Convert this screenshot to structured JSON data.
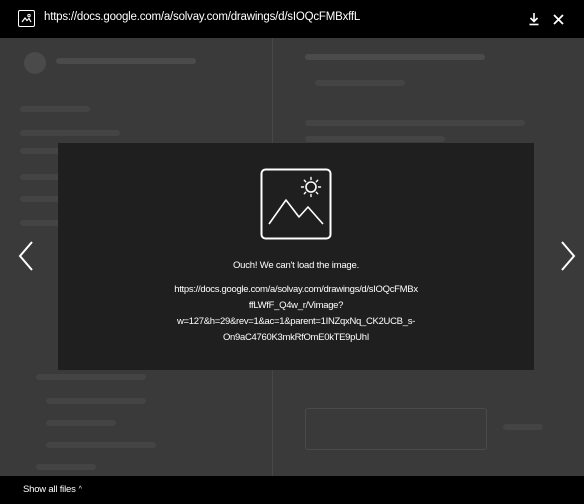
{
  "viewer": {
    "url": "https://docs.google.com/a/solvay.com/drawings/d/sIOQcFMBxffL",
    "download_icon": "download-icon",
    "close_icon": "close-icon",
    "file_icon": "drawing-file-icon"
  },
  "error": {
    "icon": "broken-image-icon",
    "message": "Ouch! We can't load the image.",
    "url_lines": [
      "https://docs.google.com/a/solvay.com/drawings/d/sIOQcFMBx",
      "ffLWfF_Q4w_r/Vimage?",
      "w=127&h=29&rev=1&ac=1&parent=1INZqxNq_CK2UCB_s-",
      "On9aC4760K3mkRfOmE0kTE9pUhI"
    ]
  },
  "navigation": {
    "prev_icon": "chevron-left-icon",
    "next_icon": "chevron-right-icon"
  },
  "footer": {
    "show_all_label": "Show all files",
    "show_all_caret": "^"
  },
  "colors": {
    "bar_background": "#000000",
    "backdrop": "#3a3a3a",
    "dialog_background": "#1f1f1f",
    "foreground": "#ffffff"
  }
}
